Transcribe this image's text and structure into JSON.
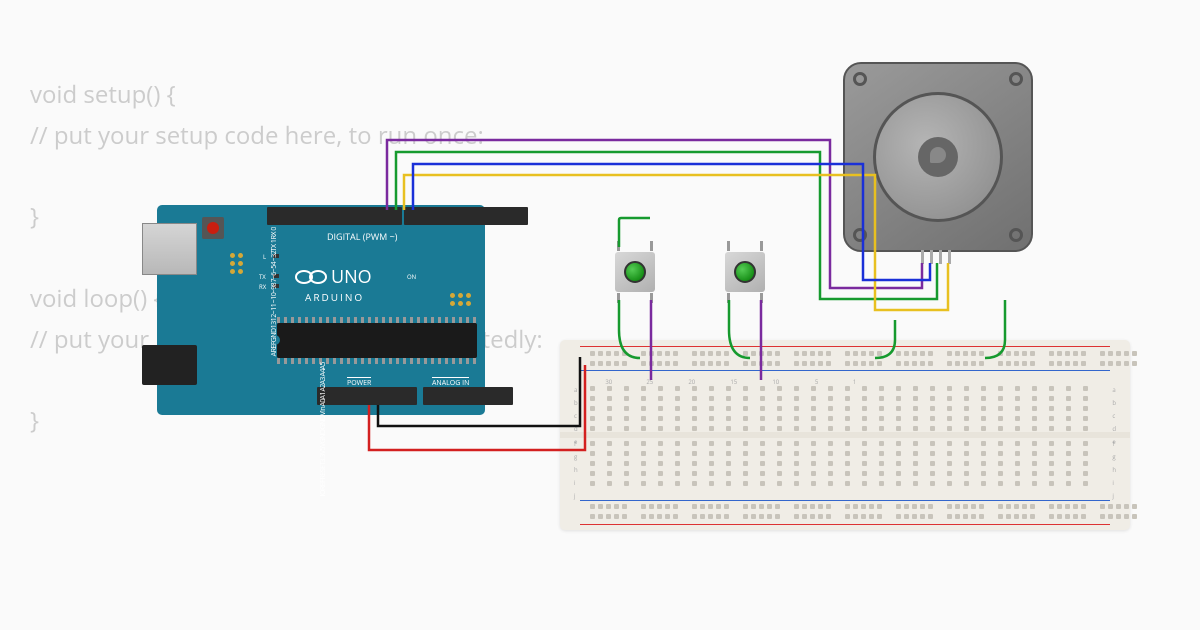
{
  "code": {
    "line1": "void setup() {",
    "line2": "  // put your setup code here, to run once:",
    "line3": "}",
    "line4": "void loop() {",
    "line5": "  // put your main code here, to run repeatedly:",
    "line6": "}"
  },
  "arduino": {
    "brand": "ARDUINO",
    "model": "UNO",
    "digital_label": "DIGITAL (PWM ~)",
    "power_label": "POWER",
    "analog_label": "ANALOG IN",
    "tx": "TX",
    "rx": "RX",
    "l": "L",
    "on": "ON",
    "pins_top": [
      "AREF",
      "GND",
      "13",
      "12",
      "~11",
      "~10",
      "~9",
      "8",
      "7",
      "~6",
      "~5",
      "4",
      "~3",
      "2",
      "TX 1",
      "RX 0"
    ],
    "pins_bottom": [
      "IOREF",
      "RESET",
      "3.3V",
      "5V",
      "GND",
      "GND",
      "Vin",
      "A0",
      "A1",
      "A2",
      "A3",
      "A4",
      "A5"
    ]
  },
  "breadboard": {
    "numbers": [
      "1",
      "5",
      "10",
      "15",
      "20",
      "25",
      "30"
    ],
    "letters_top": [
      "a",
      "b",
      "c",
      "d",
      "e"
    ],
    "letters_bot": [
      "f",
      "g",
      "h",
      "i",
      "j"
    ],
    "plus": "+",
    "minus": "−"
  },
  "components": {
    "button1": "push-button",
    "button2": "push-button",
    "motor": "stepper-motor",
    "board": "arduino-uno",
    "bb": "breadboard"
  },
  "wires": [
    {
      "name": "5v-to-rail",
      "color": "#d32020"
    },
    {
      "name": "gnd-to-rail",
      "color": "#111"
    },
    {
      "name": "d9-purple",
      "color": "#7a2a9e"
    },
    {
      "name": "d8-green",
      "color": "#169a2e"
    },
    {
      "name": "d7-yellow",
      "color": "#e8c020"
    },
    {
      "name": "d6-blue",
      "color": "#1a30d8"
    },
    {
      "name": "btn1-green",
      "color": "#169a2e"
    },
    {
      "name": "btn1-purple",
      "color": "#7a2a9e"
    },
    {
      "name": "btn2-green",
      "color": "#169a2e"
    },
    {
      "name": "btn2-purple",
      "color": "#7a2a9e"
    },
    {
      "name": "motor-grey",
      "color": "#999"
    },
    {
      "name": "motor-blue",
      "color": "#1a30d8"
    },
    {
      "name": "motor-green",
      "color": "#169a2e"
    },
    {
      "name": "motor-yellow",
      "color": "#e8c020"
    }
  ]
}
